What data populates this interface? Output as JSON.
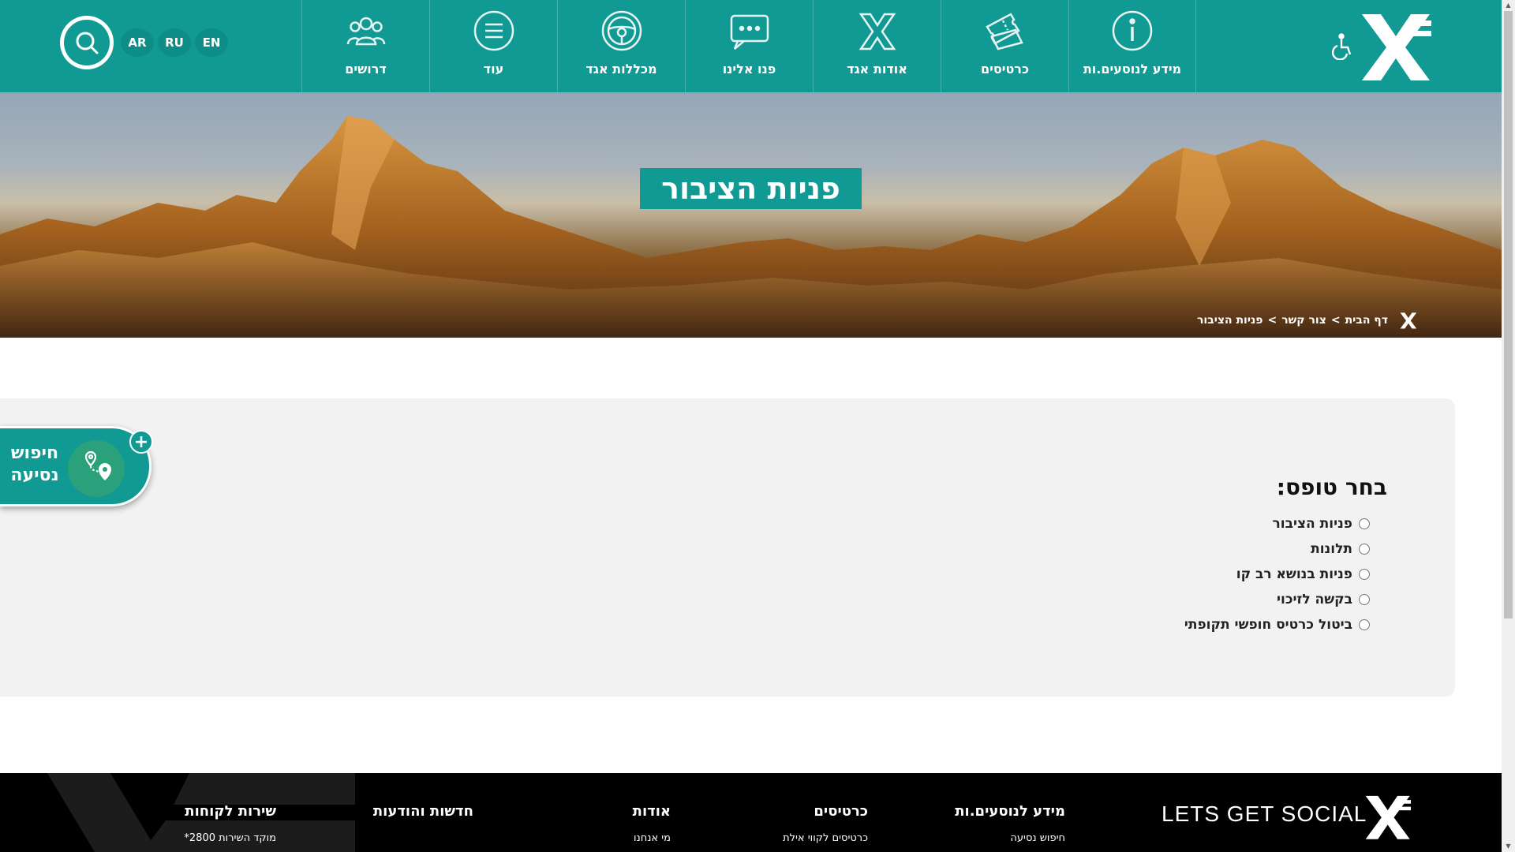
{
  "header": {
    "nav": [
      {
        "label": "דרושים",
        "icon": "people-icon"
      },
      {
        "label": "עוד",
        "icon": "menu-icon"
      },
      {
        "label": "מכללות אגד",
        "icon": "steering-wheel-icon"
      },
      {
        "label": "פנו אלינו",
        "icon": "chat-icon"
      },
      {
        "label": "אודות אגד",
        "icon": "egged-x-icon"
      },
      {
        "label": "כרטיסים",
        "icon": "ticket-icon"
      },
      {
        "label": "מידע לנוסעים.ות",
        "icon": "info-icon"
      }
    ],
    "languages": [
      "AR",
      "RU",
      "EN"
    ]
  },
  "hero": {
    "title": "פניות הציבור",
    "breadcrumb": [
      "דף הבית",
      "צור קשר",
      "פניות הציבור"
    ],
    "separator": ">"
  },
  "form": {
    "title": "בחר טופס:",
    "options": [
      "פניות הציבור",
      "תלונות",
      "פניות בנושא רב קו",
      "בקשה לזיכוי",
      "ביטול כרטיס חופשי תקופתי"
    ]
  },
  "trip_finder": {
    "line1": "חיפוש",
    "line2": "נסיעה",
    "plus": "+"
  },
  "footer": {
    "social": "LETS GET SOCIAL",
    "columns": [
      {
        "heading": "מידע לנוסעים.ות",
        "link": "חיפוש נסיעה"
      },
      {
        "heading": "כרטיסים",
        "link": "כרטיסים לקווי אילת"
      },
      {
        "heading": "אודות",
        "link": "מי אנחנו"
      },
      {
        "heading": "חדשות והודעות",
        "link": ""
      },
      {
        "heading": "שירות לקוחות",
        "link": "מוקד השירות 2800*"
      }
    ]
  },
  "colors": {
    "brand": "#109a93",
    "footer": "#000000",
    "card": "#f2f2f2"
  }
}
